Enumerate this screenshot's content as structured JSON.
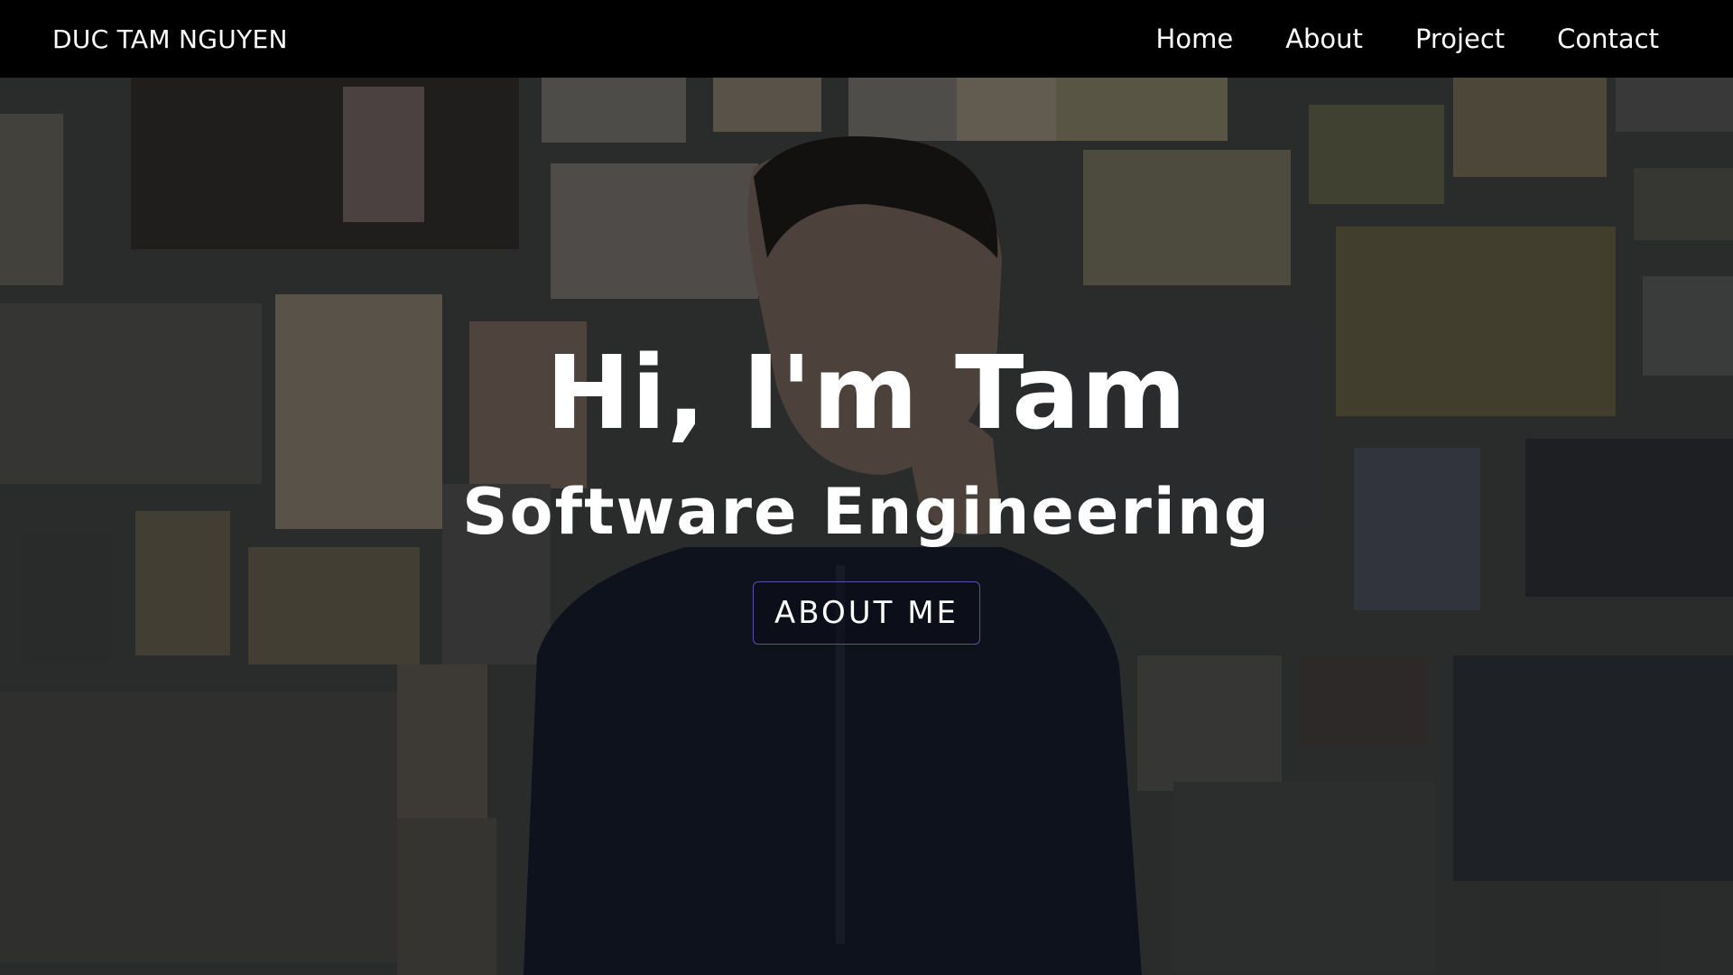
{
  "navbar": {
    "brand": "DUC TAM NGUYEN",
    "links": [
      "Home",
      "About",
      "Project",
      "Contact"
    ]
  },
  "hero": {
    "title": "Hi, I'm Tam",
    "subtitle": "Software Engineering",
    "button_label": "ABOUT ME"
  },
  "colors": {
    "navbar_bg": "#000000",
    "text": "#ffffff",
    "button_border": "#5a4fa8"
  }
}
